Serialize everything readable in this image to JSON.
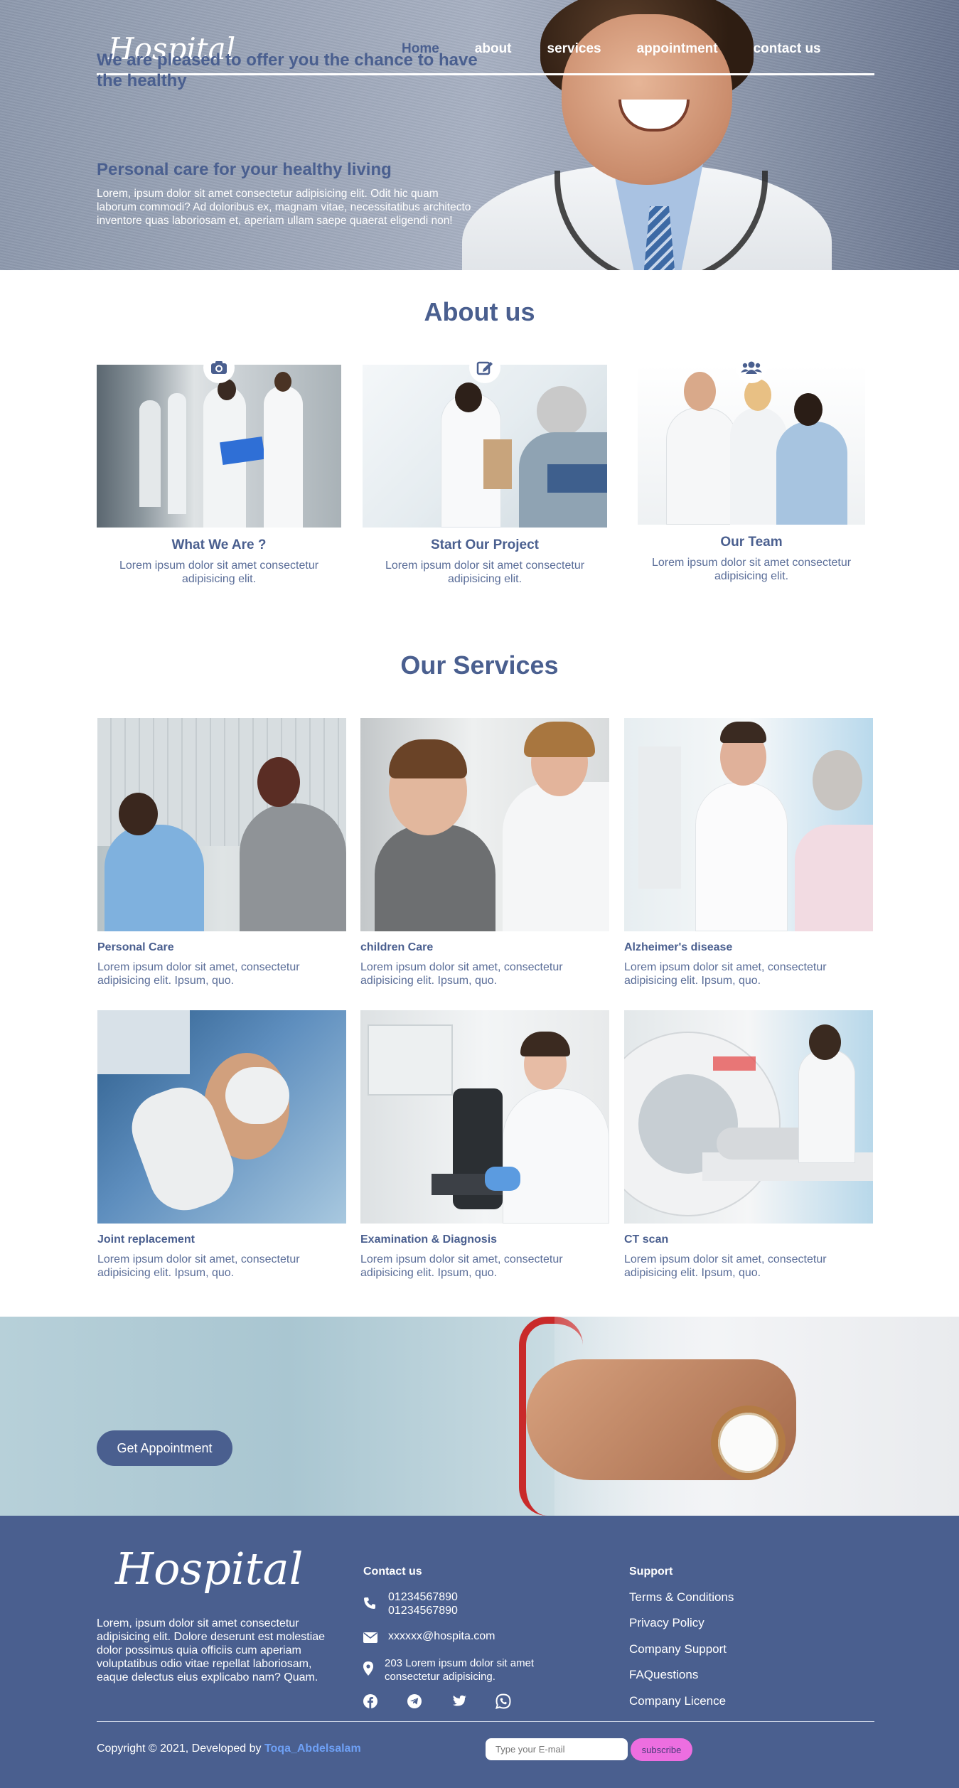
{
  "header": {
    "logo": "Hospital",
    "nav": [
      {
        "label": "Home",
        "active": true
      },
      {
        "label": "about"
      },
      {
        "label": "services"
      },
      {
        "label": "appointment"
      },
      {
        "label": "contact us"
      }
    ]
  },
  "hero": {
    "title": "Personal care for your healthy living",
    "text": "Lorem, ipsum dolor sit amet consectetur adipisicing elit. Odit hic quam laborum commodi? Ad doloribus ex, magnam vitae, necessitatibus architecto inventore quas laboriosam et, aperiam ullam saepe quaerat eligendi non!"
  },
  "about": {
    "title": "About us",
    "cards": [
      {
        "icon": "camera-icon",
        "heading": "What We Are ?",
        "text": "Lorem ipsum dolor sit amet consectetur adipisicing elit."
      },
      {
        "icon": "edit-icon",
        "heading": "Start Our Project",
        "text": "Lorem ipsum dolor sit amet consectetur adipisicing elit."
      },
      {
        "icon": "users-icon",
        "heading": "Our Team",
        "text": "Lorem ipsum dolor sit amet consectetur adipisicing elit."
      }
    ]
  },
  "services": {
    "title": "Our Services",
    "items": [
      {
        "title": "Personal Care",
        "text": "Lorem ipsum dolor sit amet, consectetur adipisicing elit. Ipsum, quo."
      },
      {
        "title": "children Care",
        "text": "Lorem ipsum dolor sit amet, consectetur adipisicing elit. Ipsum, quo."
      },
      {
        "title": "Alzheimer's disease",
        "text": "Lorem ipsum dolor sit amet, consectetur adipisicing elit. Ipsum, quo."
      },
      {
        "title": "Joint replacement",
        "text": "Lorem ipsum dolor sit amet, consectetur adipisicing elit. Ipsum, quo."
      },
      {
        "title": "Examination & Diagnosis",
        "text": "Lorem ipsum dolor sit amet, consectetur adipisicing elit. Ipsum, quo."
      },
      {
        "title": "CT scan",
        "text": "Lorem ipsum dolor sit amet, consectetur adipisicing elit. Ipsum, quo."
      }
    ]
  },
  "cta": {
    "title": "We are pleased to offer you the chance to have the healthy",
    "button": "Get Appointment"
  },
  "footer": {
    "logo": "Hospital",
    "about": "Lorem, ipsum dolor sit amet consectetur adipisicing elit. Dolore deserunt est molestiae dolor possimus quia officiis cum aperiam voluptatibus odio vitae repellat laboriosam, eaque delectus eius explicabo nam? Quam.",
    "contact": {
      "heading": "Contact us",
      "phone1": "01234567890",
      "phone2": "01234567890",
      "email": "xxxxxx@hospita.com",
      "address": "203 Lorem ipsum dolor sit amet consectetur adipisicing."
    },
    "support": {
      "heading": "Support",
      "links": [
        "Terms & Conditions",
        "Privacy Policy",
        "Company Support",
        "FAQuestions",
        "Company Licence"
      ]
    },
    "copyright_prefix": "Copyright © 2021, Developed by",
    "developer": "Toqa_Abdelsalam",
    "email_placeholder": "Type your E-mail",
    "subscribe": "subscribe",
    "social": [
      "facebook-icon",
      "telegram-icon",
      "twitter-icon",
      "whatsapp-icon"
    ]
  },
  "colors": {
    "primary": "#4a5f8f",
    "subscribe": "#ed6ee0",
    "developer_link": "#6ea0f5"
  }
}
